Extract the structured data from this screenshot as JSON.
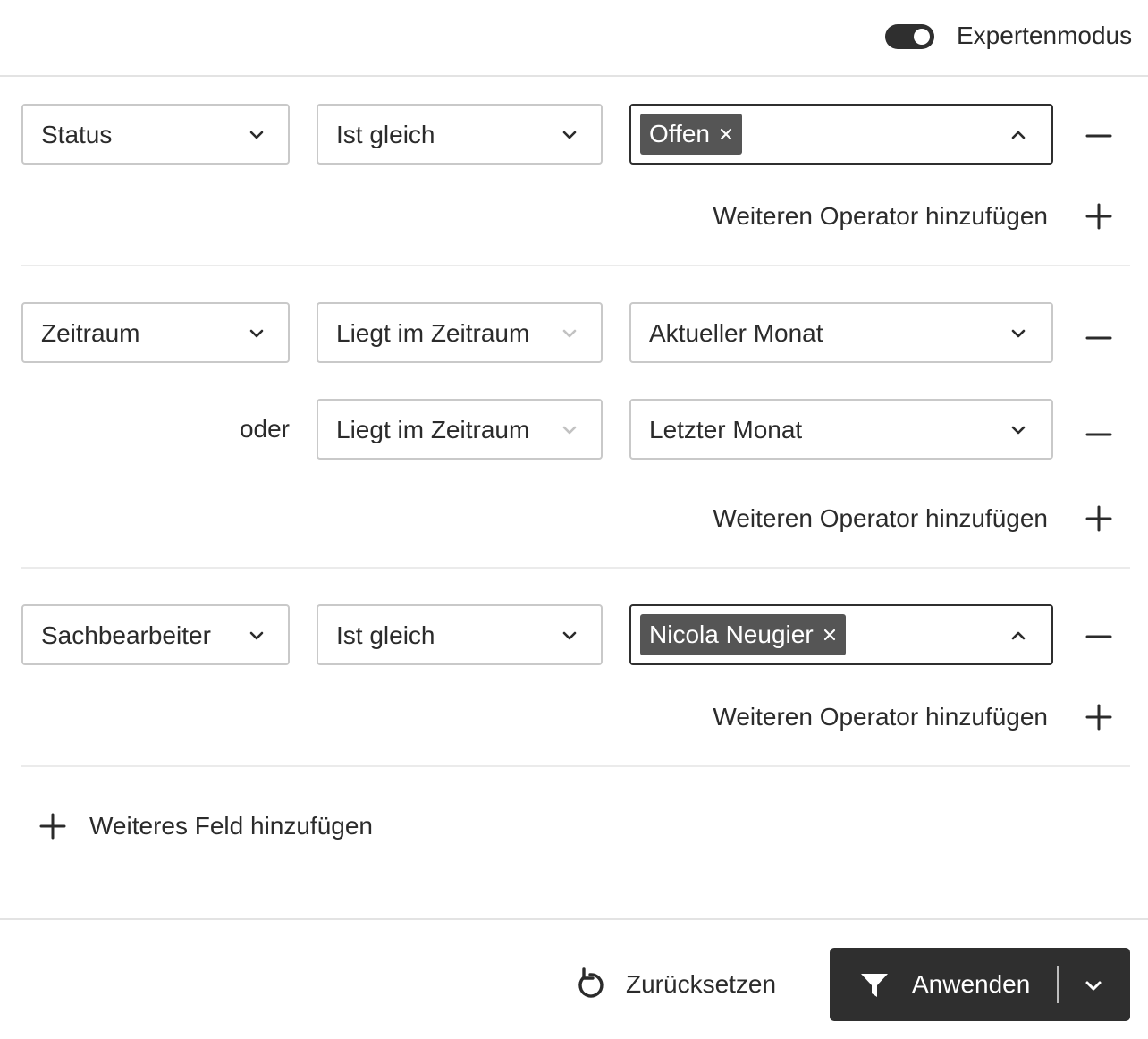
{
  "header": {
    "expert_mode_label": "Expertenmodus",
    "expert_mode_on": true
  },
  "filters": [
    {
      "field": "Status",
      "rows": [
        {
          "connector": "",
          "operator": "Ist gleich",
          "operator_disabled": false,
          "value_chip": "Offen",
          "value_open": true
        }
      ],
      "add_operator_label": "Weiteren Operator hinzufügen"
    },
    {
      "field": "Zeitraum",
      "rows": [
        {
          "connector": "",
          "operator": "Liegt im Zeitraum",
          "operator_disabled": true,
          "value": "Aktueller Monat",
          "value_open": false
        },
        {
          "connector": "oder",
          "operator": "Liegt im Zeitraum",
          "operator_disabled": true,
          "value": "Letzter Monat",
          "value_open": false
        }
      ],
      "add_operator_label": "Weiteren Operator hinzufügen"
    },
    {
      "field": "Sachbearbeiter",
      "rows": [
        {
          "connector": "",
          "operator": "Ist gleich",
          "operator_disabled": false,
          "value_chip": "Nicola Neugier",
          "value_open": true
        }
      ],
      "add_operator_label": "Weiteren Operator hinzufügen"
    }
  ],
  "add_field_label": "Weiteres Feld hinzufügen",
  "footer": {
    "reset_label": "Zurücksetzen",
    "apply_label": "Anwenden"
  },
  "icons": {
    "toggle": "toggle-switch-icon",
    "chevron_down": "chevron-down-icon",
    "chevron_up": "chevron-up-icon",
    "remove_chip": "close-icon",
    "remove_row": "minus-icon",
    "add": "plus-icon",
    "reset": "reset-icon",
    "filter": "filter-icon"
  },
  "colors": {
    "dark": "#2f2f2f",
    "chip": "#555555",
    "border": "#c9c9c9",
    "disabled_chevron": "#bdbdbd"
  }
}
